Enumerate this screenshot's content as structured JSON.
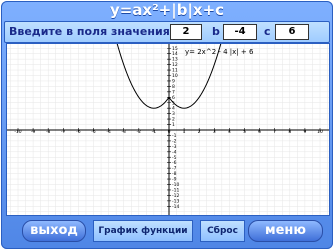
{
  "app": {
    "title": "y=ax²+|b|x+c",
    "prompt": "Введите в поля значения а",
    "labels": {
      "b": "b",
      "c": "c"
    },
    "values": {
      "a": "2",
      "b": "-4",
      "c": "6"
    },
    "buttons": {
      "exit": "выход",
      "plot": "График функции",
      "reset": "Сброс",
      "menu": "меню"
    }
  },
  "graph": {
    "equation_label": "y= 2x^2 - 4 |x| + 6",
    "x_ticks": [
      "-10",
      "-9",
      "-8",
      "-7",
      "-6",
      "-5",
      "-4",
      "-3",
      "-2",
      "-1",
      "0",
      "1",
      "2",
      "3",
      "4",
      "5",
      "6",
      "7",
      "8",
      "9",
      "10"
    ],
    "y_ticks": [
      "15",
      "14",
      "13",
      "12",
      "11",
      "10",
      "9",
      "8",
      "7",
      "6",
      "5",
      "4",
      "3",
      "2",
      "1",
      "0",
      "-1",
      "-2",
      "-3",
      "-4",
      "-5",
      "-6",
      "-7",
      "-8",
      "-9",
      "-10",
      "-11",
      "-12",
      "-13",
      "-14"
    ],
    "x_range": [
      -10,
      10
    ],
    "y_range": [
      -15,
      15
    ],
    "curve": {
      "a": 2,
      "b": -4,
      "c": 6
    }
  }
}
